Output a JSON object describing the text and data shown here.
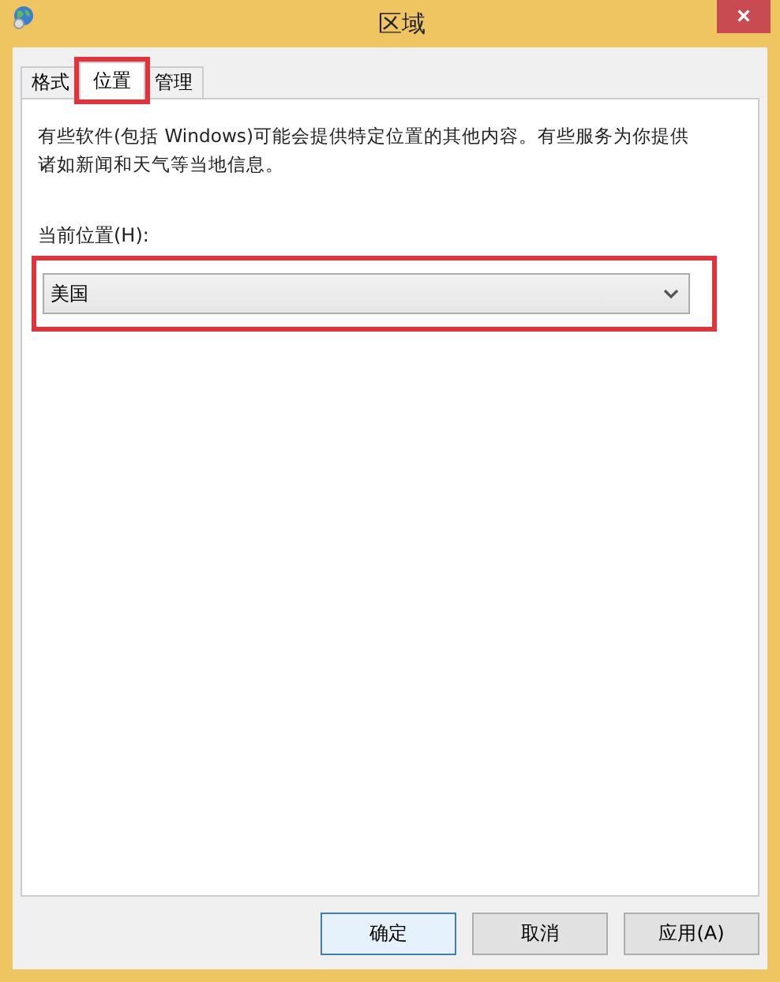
{
  "window": {
    "title": "区域",
    "close": "×"
  },
  "tabs": [
    {
      "label": "格式",
      "selected": false
    },
    {
      "label": "位置",
      "selected": true,
      "highlighted": true
    },
    {
      "label": "管理",
      "selected": false
    }
  ],
  "description": "有些软件(包括 Windows)可能会提供特定位置的其他内容。有些服务为你提供诸如新闻和天气等当地信息。",
  "location": {
    "label": "当前位置(H):",
    "value": "美国",
    "highlighted": true
  },
  "buttons": [
    {
      "label": "确定",
      "default": true
    },
    {
      "label": "取消",
      "default": false
    },
    {
      "label": "应用(A)",
      "default": false
    }
  ]
}
